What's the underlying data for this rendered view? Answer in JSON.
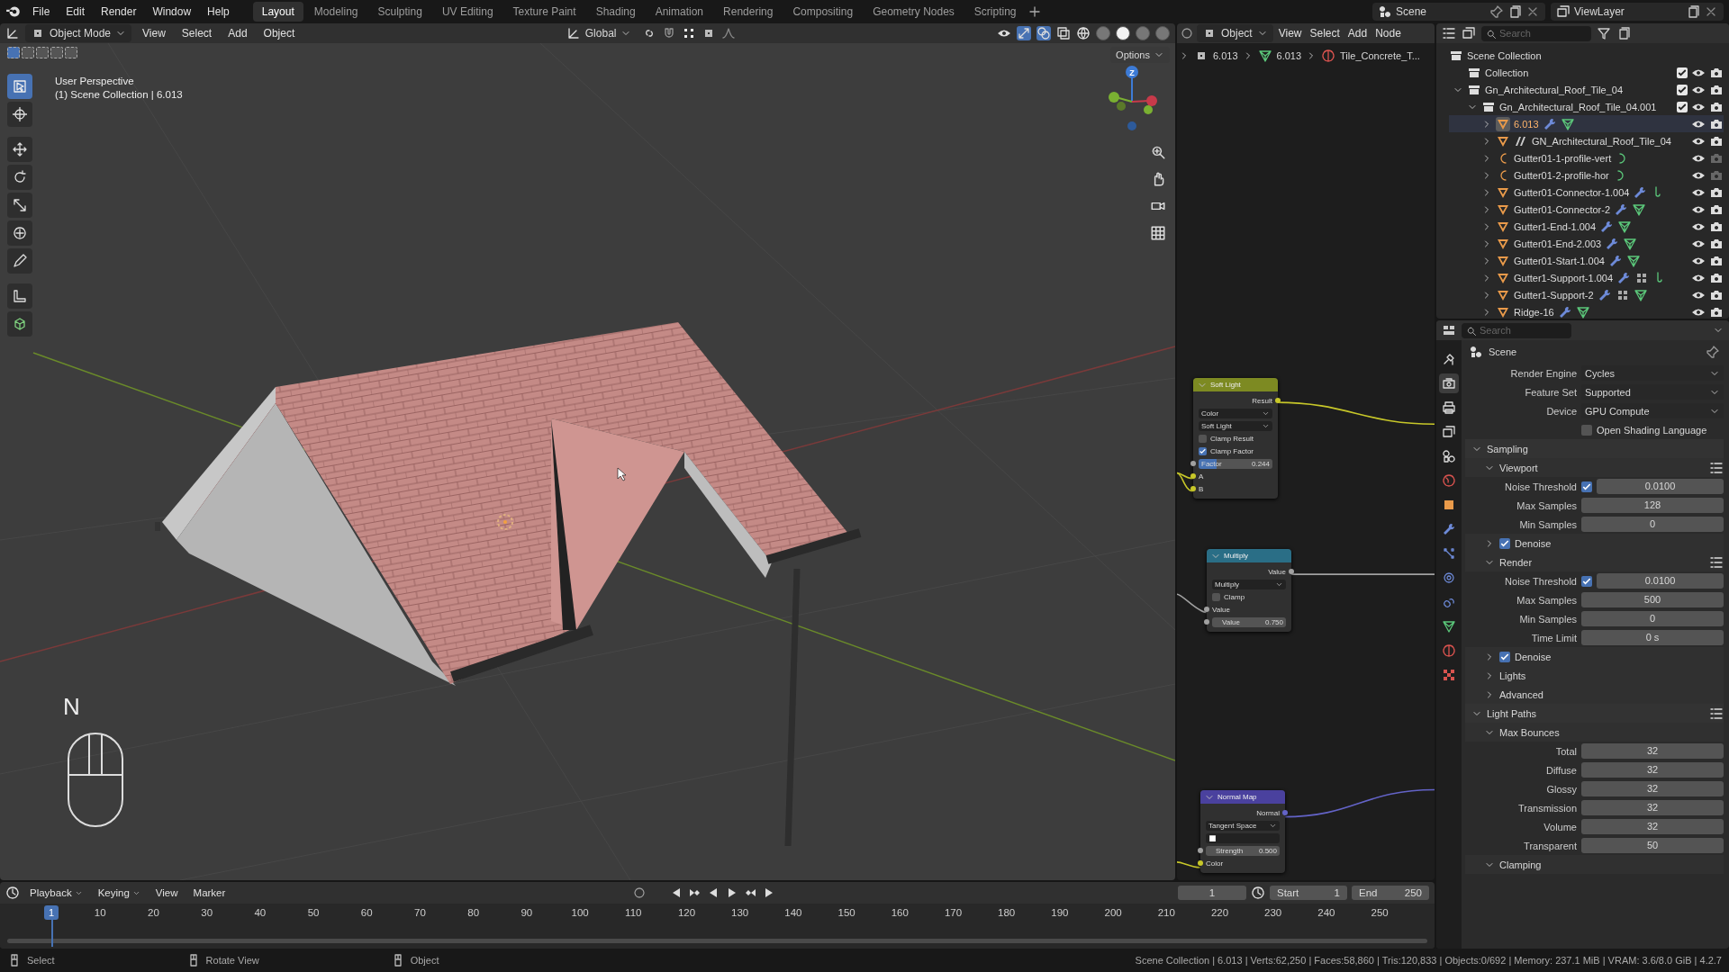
{
  "top_bar": {
    "menus": [
      "File",
      "Edit",
      "Render",
      "Window",
      "Help"
    ],
    "workspaces": [
      {
        "label": "Layout",
        "selected": true
      },
      {
        "label": "Modeling",
        "selected": false
      },
      {
        "label": "Sculpting",
        "selected": false
      },
      {
        "label": "UV Editing",
        "selected": false
      },
      {
        "label": "Texture Paint",
        "selected": false
      },
      {
        "label": "Shading",
        "selected": false
      },
      {
        "label": "Animation",
        "selected": false
      },
      {
        "label": "Rendering",
        "selected": false
      },
      {
        "label": "Compositing",
        "selected": false
      },
      {
        "label": "Geometry Nodes",
        "selected": false
      },
      {
        "label": "Scripting",
        "selected": false
      }
    ],
    "scene": "Scene",
    "view_layer": "ViewLayer"
  },
  "viewport": {
    "mode": "Object Mode",
    "menus": [
      "View",
      "Select",
      "Add",
      "Object"
    ],
    "orientation": "Global",
    "options": "Options",
    "select_modes": [
      {
        "selected": true
      },
      {
        "selected": false
      },
      {
        "selected": false
      },
      {
        "selected": false
      },
      {
        "selected": false
      }
    ],
    "shading_modes": [
      {
        "selected": false
      },
      {
        "selected": true
      },
      {
        "selected": false
      },
      {
        "selected": false
      }
    ],
    "info": [
      "User Perspective",
      "(1) Scene Collection | 6.013"
    ],
    "tools": [
      {
        "selected": true
      },
      {
        "selected": false
      },
      {
        "selected": false
      },
      {
        "selected": false
      },
      {
        "selected": false
      },
      {
        "selected": false
      },
      {
        "selected": false
      },
      {
        "selected": false
      },
      {
        "selected": false
      }
    ],
    "gizmo_label": "Z",
    "key_hint": "N"
  },
  "node_editor": {
    "object": "Object",
    "menus": [
      "View",
      "Select",
      "Add",
      "Node"
    ],
    "breadcrumbs": [
      "6.013",
      "6.013",
      "Tile_Concrete_T..."
    ],
    "nodes": [
      {
        "title": "Soft Light",
        "color": "#7d8a22",
        "items": [
          {
            "kind": "output",
            "label": "Result",
            "color": "#c7c729"
          },
          {
            "kind": "dropdown",
            "label": "Color"
          },
          {
            "kind": "dropdown",
            "label": "Soft Light"
          },
          {
            "kind": "checkbox",
            "label": "Clamp Result",
            "checked": false
          },
          {
            "kind": "checkbox",
            "label": "Clamp Factor",
            "checked": true
          },
          {
            "kind": "slider",
            "label": "Factor",
            "value": "0.244",
            "level": 0.244,
            "color": "#a1a1a1"
          },
          {
            "kind": "input",
            "label": "A",
            "color": "#c7c729"
          },
          {
            "kind": "input",
            "label": "B",
            "color": "#c7c729"
          }
        ]
      },
      {
        "title": "Multiply",
        "color": "#2a6e86",
        "items": [
          {
            "kind": "output",
            "label": "Value",
            "color": "#a1a1a1"
          },
          {
            "kind": "dropdown",
            "label": "Multiply"
          },
          {
            "kind": "checkbox",
            "label": "Clamp",
            "checked": false
          },
          {
            "kind": "input",
            "label": "Value",
            "color": "#a1a1a1"
          },
          {
            "kind": "field",
            "label": "Value",
            "value": "0.750",
            "color": "#a1a1a1"
          }
        ]
      },
      {
        "title": "Normal Map",
        "color": "#4a419e",
        "items": [
          {
            "kind": "output",
            "label": "Normal",
            "color": "#6363c7"
          },
          {
            "kind": "dropdown",
            "label": "Tangent Space"
          },
          {
            "kind": "image"
          },
          {
            "kind": "field",
            "label": "Strength",
            "value": "0.500",
            "color": "#a1a1a1"
          },
          {
            "kind": "input",
            "label": "Color",
            "color": "#c7c729"
          }
        ]
      }
    ]
  },
  "outliner": {
    "search_placeholder": "Search",
    "root": "Scene Collection",
    "items": [
      {
        "name": "Collection",
        "kind": "collection",
        "checked": true,
        "selected": false,
        "renderable": true
      },
      {
        "name": "Gn_Architectural_Roof_Tile_04",
        "kind": "collection",
        "expanded": true,
        "checked": true,
        "selected": false,
        "renderable": true,
        "children": [
          {
            "name": "Gn_Architectural_Roof_Tile_04.001",
            "kind": "collection",
            "expanded": true,
            "checked": true,
            "selected": false,
            "renderable": true,
            "children": [
              {
                "name": "6.013",
                "kind": "mesh",
                "expanded": false,
                "selected": true,
                "renderable": true,
                "badges": [
                  {
                    "kind": "modifier"
                  },
                  {
                    "kind": "mesh_data"
                  }
                ]
              },
              {
                "name": "GN_Architectural_Roof_Tile_04",
                "kind": "mesh",
                "expanded": false,
                "selected": false,
                "renderable": true,
                "pre_badges": [
                  {
                    "kind": "nodes"
                  }
                ]
              },
              {
                "name": "Gutter01-1-profile-vert",
                "kind": "curve",
                "expanded": false,
                "selected": false,
                "renderable": false,
                "badges": [
                  {
                    "kind": "curve_data"
                  }
                ]
              },
              {
                "name": "Gutter01-2-profile-hor",
                "kind": "curve",
                "expanded": false,
                "selected": false,
                "renderable": false,
                "badges": [
                  {
                    "kind": "curve_data"
                  }
                ]
              },
              {
                "name": "Gutter01-Connector-1.004",
                "kind": "mesh",
                "expanded": false,
                "selected": false,
                "renderable": true,
                "badges": [
                  {
                    "kind": "modifier"
                  },
                  {
                    "kind": "hook"
                  }
                ]
              },
              {
                "name": "Gutter01-Connector-2",
                "kind": "mesh",
                "expanded": false,
                "selected": false,
                "renderable": true,
                "badges": [
                  {
                    "kind": "modifier"
                  },
                  {
                    "kind": "mesh_data"
                  }
                ]
              },
              {
                "name": "Gutter1-End-1.004",
                "kind": "mesh",
                "expanded": false,
                "selected": false,
                "renderable": true,
                "badges": [
                  {
                    "kind": "modifier"
                  },
                  {
                    "kind": "mesh_data"
                  }
                ]
              },
              {
                "name": "Gutter01-End-2.003",
                "kind": "mesh",
                "expanded": false,
                "selected": false,
                "renderable": true,
                "badges": [
                  {
                    "kind": "modifier"
                  },
                  {
                    "kind": "mesh_data"
                  }
                ]
              },
              {
                "name": "Gutter01-Start-1.004",
                "kind": "mesh",
                "expanded": false,
                "selected": false,
                "renderable": true,
                "badges": [
                  {
                    "kind": "modifier"
                  },
                  {
                    "kind": "mesh_data"
                  }
                ]
              },
              {
                "name": "Gutter1-Support-1.004",
                "kind": "mesh",
                "expanded": false,
                "selected": false,
                "renderable": true,
                "badges": [
                  {
                    "kind": "modifier"
                  },
                  {
                    "kind": "lattice"
                  },
                  {
                    "kind": "hook"
                  }
                ]
              },
              {
                "name": "Gutter1-Support-2",
                "kind": "mesh",
                "expanded": false,
                "selected": false,
                "renderable": true,
                "badges": [
                  {
                    "kind": "modifier"
                  },
                  {
                    "kind": "lattice"
                  },
                  {
                    "kind": "mesh_data"
                  }
                ]
              },
              {
                "name": "Ridge-16",
                "kind": "mesh",
                "expanded": false,
                "selected": false,
                "renderable": true,
                "badges": [
                  {
                    "kind": "modifier"
                  },
                  {
                    "kind": "mesh_data"
                  }
                ]
              }
            ]
          }
        ]
      }
    ]
  },
  "properties": {
    "search_placeholder": "Search",
    "context": "Scene",
    "tabs": [
      {
        "selected": false
      },
      {
        "selected": true
      },
      {
        "selected": false
      },
      {
        "selected": false
      },
      {
        "selected": false
      },
      {
        "selected": false
      },
      {
        "selected": false
      },
      {
        "selected": false
      },
      {
        "selected": false
      },
      {
        "selected": false
      },
      {
        "selected": false
      },
      {
        "selected": false
      },
      {
        "selected": false
      },
      {
        "selected": false
      }
    ],
    "rows": [
      {
        "kind": "dropdown",
        "label": "Render Engine",
        "value": "Cycles"
      },
      {
        "kind": "dropdown",
        "label": "Feature Set",
        "value": "Supported"
      },
      {
        "kind": "dropdown",
        "label": "Device",
        "value": "GPU Compute"
      },
      {
        "kind": "checkbox",
        "label": "Open Shading Language",
        "checked": false
      },
      {
        "kind": "panel",
        "label": "Sampling",
        "expanded": true,
        "children": [
          {
            "kind": "panel",
            "label": "Viewport",
            "expanded": true,
            "presets": true,
            "children": [
              {
                "kind": "number",
                "label": "Noise Threshold",
                "checked": true,
                "value": "0.0100"
              },
              {
                "kind": "number",
                "label": "Max Samples",
                "value": "128"
              },
              {
                "kind": "number",
                "label": "Min Samples",
                "value": "0"
              }
            ]
          },
          {
            "kind": "panel",
            "label": "Denoise",
            "expanded": false,
            "checked": true
          },
          {
            "kind": "panel",
            "label": "Render",
            "expanded": true,
            "presets": true,
            "children": [
              {
                "kind": "number",
                "label": "Noise Threshold",
                "checked": true,
                "value": "0.0100"
              },
              {
                "kind": "number",
                "label": "Max Samples",
                "value": "500"
              },
              {
                "kind": "number",
                "label": "Min Samples",
                "value": "0"
              },
              {
                "kind": "number",
                "label": "Time Limit",
                "value": "0 s"
              }
            ]
          },
          {
            "kind": "panel",
            "label": "Denoise",
            "expanded": false,
            "checked": true
          },
          {
            "kind": "panel",
            "label": "Lights",
            "expanded": false
          },
          {
            "kind": "panel",
            "label": "Advanced",
            "expanded": false
          }
        ]
      },
      {
        "kind": "panel",
        "label": "Light Paths",
        "expanded": true,
        "presets": true,
        "children": [
          {
            "kind": "panel",
            "label": "Max Bounces",
            "expanded": true,
            "children": [
              {
                "kind": "number",
                "label": "Total",
                "value": "32"
              },
              {
                "kind": "number",
                "label": "Diffuse",
                "value": "32"
              },
              {
                "kind": "number",
                "label": "Glossy",
                "value": "32"
              },
              {
                "kind": "number",
                "label": "Transmission",
                "value": "32"
              },
              {
                "kind": "number",
                "label": "Volume",
                "value": "32"
              },
              {
                "kind": "number",
                "label": "Transparent",
                "value": "50"
              }
            ]
          },
          {
            "kind": "panel",
            "label": "Clamping",
            "expanded": true
          }
        ]
      }
    ]
  },
  "timeline": {
    "menus": [
      "Playback",
      "Keying",
      "View",
      "Marker"
    ],
    "frame": "1",
    "start_label": "Start",
    "start": "1",
    "end_label": "End",
    "end": "250",
    "current_frame": "1",
    "ruler": [
      "10",
      "20",
      "30",
      "40",
      "50",
      "60",
      "70",
      "80",
      "90",
      "100",
      "110",
      "120",
      "130",
      "140",
      "150",
      "160",
      "170",
      "180",
      "190",
      "200",
      "210",
      "220",
      "230",
      "240",
      "250"
    ]
  },
  "status_bar": {
    "hints": [
      "Select",
      "Rotate View",
      "Object"
    ],
    "stats": "Scene Collection | 6.013 | Verts:62,250 | Faces:58,860 | Tris:120,833 | Objects:0/692 | Memory: 237.1 MiB | VRAM: 3.6/8.0 GiB | 4.2.7"
  }
}
